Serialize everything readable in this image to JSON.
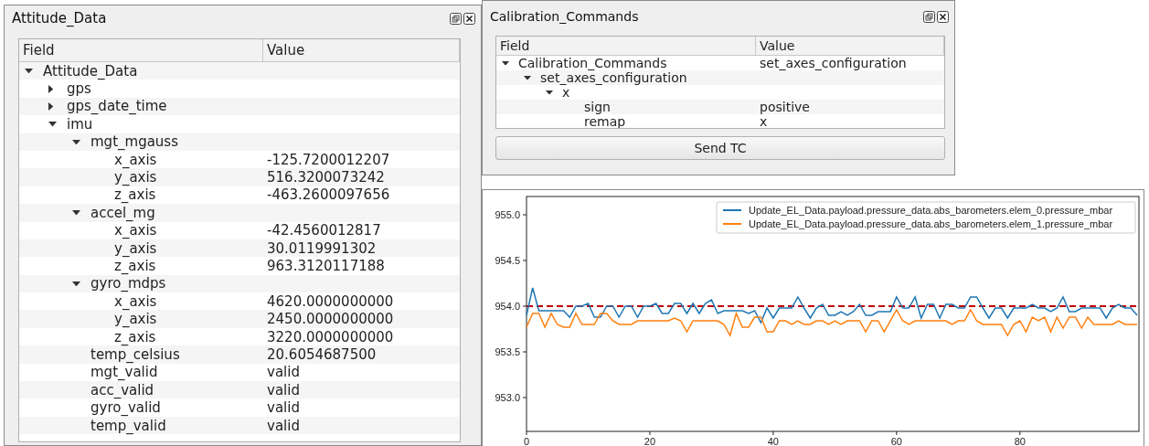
{
  "attitude_window": {
    "title": "Attitude_Data",
    "columns": [
      "Field",
      "Value"
    ],
    "tree": [
      {
        "field": "Attitude_Data",
        "expanded": true,
        "children": [
          {
            "field": "gps",
            "expanded": false
          },
          {
            "field": "gps_date_time",
            "expanded": false
          },
          {
            "field": "imu",
            "expanded": true,
            "children": [
              {
                "field": "mgt_mgauss",
                "expanded": true,
                "children": [
                  {
                    "field": "x_axis",
                    "value": "-125.7200012207"
                  },
                  {
                    "field": "y_axis",
                    "value": "516.3200073242"
                  },
                  {
                    "field": "z_axis",
                    "value": "-463.2600097656"
                  }
                ]
              },
              {
                "field": "accel_mg",
                "expanded": true,
                "children": [
                  {
                    "field": "x_axis",
                    "value": "-42.4560012817"
                  },
                  {
                    "field": "y_axis",
                    "value": "30.0119991302"
                  },
                  {
                    "field": "z_axis",
                    "value": "963.3120117188"
                  }
                ]
              },
              {
                "field": "gyro_mdps",
                "expanded": true,
                "children": [
                  {
                    "field": "x_axis",
                    "value": "4620.0000000000"
                  },
                  {
                    "field": "y_axis",
                    "value": "2450.0000000000"
                  },
                  {
                    "field": "z_axis",
                    "value": "3220.0000000000"
                  }
                ]
              },
              {
                "field": "temp_celsius",
                "value": "20.6054687500"
              },
              {
                "field": "mgt_valid",
                "value": "valid"
              },
              {
                "field": "acc_valid",
                "value": "valid"
              },
              {
                "field": "gyro_valid",
                "value": "valid"
              },
              {
                "field": "temp_valid",
                "value": "valid"
              }
            ]
          }
        ]
      }
    ]
  },
  "calibration_window": {
    "title": "Calibration_Commands",
    "columns": [
      "Field",
      "Value"
    ],
    "tree": [
      {
        "field": "Calibration_Commands",
        "value": "set_axes_configuration",
        "expanded": true,
        "children": [
          {
            "field": "set_axes_configuration",
            "expanded": true,
            "children": [
              {
                "field": "x",
                "expanded": true,
                "children": [
                  {
                    "field": "sign",
                    "value": "positive"
                  },
                  {
                    "field": "remap",
                    "value": "x"
                  }
                ]
              }
            ]
          }
        ]
      }
    ],
    "send_button": "Send TC"
  },
  "plot": {
    "chart_data": {
      "type": "line",
      "legend": true,
      "x": [
        0,
        1,
        2,
        3,
        4,
        5,
        6,
        7,
        8,
        9,
        10,
        11,
        12,
        13,
        14,
        15,
        16,
        17,
        18,
        19,
        20,
        21,
        22,
        23,
        24,
        25,
        26,
        27,
        28,
        29,
        30,
        31,
        32,
        33,
        34,
        35,
        36,
        37,
        38,
        39,
        40,
        41,
        42,
        43,
        44,
        45,
        46,
        47,
        48,
        49,
        50,
        51,
        52,
        53,
        54,
        55,
        56,
        57,
        58,
        59,
        60,
        61,
        62,
        63,
        64,
        65,
        66,
        67,
        68,
        69,
        70,
        71,
        72,
        73,
        74,
        75,
        76,
        77,
        78,
        79,
        80,
        81,
        82,
        83,
        84,
        85,
        86,
        87,
        88,
        89,
        90,
        91,
        92,
        93,
        94,
        95,
        96,
        97,
        98,
        99
      ],
      "xlim": [
        0,
        99.3
      ],
      "ylim": [
        952.63,
        955.2
      ],
      "xticks": [
        0,
        20,
        40,
        60,
        80
      ],
      "yticks": [
        {
          "value": 953.0,
          "label": "953.0"
        },
        {
          "value": 953.5,
          "label": "953.5"
        },
        {
          "value": 954.0,
          "label": "954.0"
        },
        {
          "value": 954.5,
          "label": "954.5"
        },
        {
          "value": 955.0,
          "label": "955.0"
        }
      ],
      "ref_lines": [
        {
          "axis": "y",
          "value": 954.0,
          "color": "#c00000"
        }
      ],
      "series": [
        {
          "name": "Update_EL_Data.payload.pressure_data.abs_barometers.elem_0.pressure_mbar",
          "color": "#1f77b4",
          "values": [
            953.9,
            954.2,
            953.95,
            953.95,
            953.95,
            953.95,
            953.95,
            953.88,
            954.0,
            954.0,
            954.03,
            953.88,
            953.88,
            954.0,
            954.0,
            953.88,
            954.0,
            954.0,
            953.88,
            954.0,
            954.0,
            954.03,
            953.92,
            953.92,
            954.03,
            954.03,
            953.92,
            954.03,
            953.92,
            954.03,
            954.07,
            953.92,
            953.95,
            953.95,
            953.95,
            953.95,
            953.92,
            953.95,
            953.82,
            953.98,
            953.87,
            953.98,
            953.98,
            953.98,
            954.1,
            953.98,
            953.87,
            953.98,
            954.02,
            953.9,
            953.9,
            953.94,
            953.9,
            953.94,
            954.02,
            953.9,
            953.9,
            953.94,
            953.94,
            953.94,
            954.1,
            953.98,
            953.98,
            954.1,
            953.87,
            954.02,
            954.02,
            953.87,
            954.02,
            954.02,
            953.98,
            953.98,
            954.1,
            954.1,
            953.98,
            953.87,
            953.98,
            953.98,
            953.87,
            953.98,
            953.98,
            953.98,
            954.02,
            953.98,
            953.98,
            953.94,
            953.98,
            954.1,
            953.94,
            953.94,
            953.98,
            953.98,
            953.98,
            953.98,
            953.87,
            953.98,
            954.02,
            953.98,
            953.98,
            953.9
          ]
        },
        {
          "name": "Update_EL_Data.payload.pressure_data.abs_barometers.elem_1.pressure_mbar",
          "color": "#ff7f0e",
          "values": [
            953.77,
            953.92,
            953.92,
            953.77,
            953.92,
            953.8,
            953.77,
            953.77,
            953.92,
            953.8,
            953.8,
            953.8,
            953.92,
            953.92,
            953.84,
            953.8,
            953.8,
            953.8,
            953.84,
            953.84,
            953.84,
            953.84,
            953.84,
            953.84,
            953.87,
            953.84,
            953.72,
            953.84,
            953.84,
            953.84,
            953.84,
            953.84,
            953.8,
            953.68,
            953.92,
            953.77,
            953.77,
            953.88,
            953.88,
            953.72,
            953.72,
            953.84,
            953.84,
            953.8,
            953.84,
            953.8,
            953.8,
            953.84,
            953.84,
            953.8,
            953.84,
            953.8,
            953.84,
            953.84,
            953.84,
            953.72,
            953.84,
            953.84,
            953.72,
            953.84,
            953.96,
            953.84,
            953.8,
            953.84,
            953.84,
            953.84,
            953.84,
            953.84,
            953.84,
            953.8,
            953.84,
            953.84,
            953.96,
            953.84,
            953.8,
            953.8,
            953.8,
            953.8,
            953.68,
            953.8,
            953.84,
            953.72,
            953.88,
            953.84,
            953.88,
            953.72,
            953.88,
            953.76,
            953.88,
            953.88,
            953.76,
            953.88,
            953.8,
            953.8,
            953.8,
            953.8,
            953.84,
            953.8,
            953.8,
            953.8
          ]
        }
      ]
    }
  }
}
